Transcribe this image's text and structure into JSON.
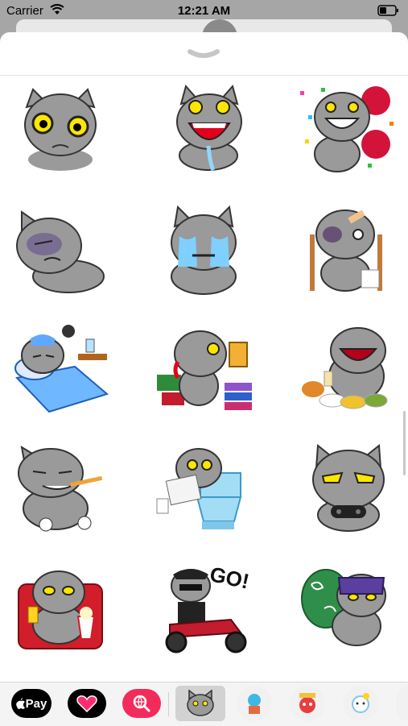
{
  "status_bar": {
    "carrier": "Carrier",
    "time": "12:21 AM",
    "wifi_icon": "wifi-icon",
    "battery_icon": "battery-icon"
  },
  "sheet": {
    "handle_icon": "chevron-down-icon"
  },
  "stickers": [
    {
      "id": "sad-cat"
    },
    {
      "id": "drooling-cat"
    },
    {
      "id": "cheering-cat"
    },
    {
      "id": "bruised-sad-cat"
    },
    {
      "id": "crying-cat"
    },
    {
      "id": "injured-crutches-cat"
    },
    {
      "id": "sleeping-cat"
    },
    {
      "id": "phone-books-cat"
    },
    {
      "id": "eating-feast-cat"
    },
    {
      "id": "toothbrush-cat"
    },
    {
      "id": "toilet-newspaper-cat"
    },
    {
      "id": "gamer-cat"
    },
    {
      "id": "popcorn-couch-cat"
    },
    {
      "id": "biker-cat",
      "text": "GO!"
    },
    {
      "id": "thief-bundle-cat"
    }
  ],
  "app_drawer": {
    "apple_pay": "Pay",
    "apps": [
      "apple-pay",
      "digital-touch",
      "image-search",
      "cat-stickers",
      "sticker-pack-2",
      "sticker-pack-3",
      "sticker-pack-4"
    ]
  },
  "colors": {
    "cat_gray": "#9a9a9a",
    "eye_yellow": "#ffe600",
    "accent_pink": "#f22b5b"
  }
}
